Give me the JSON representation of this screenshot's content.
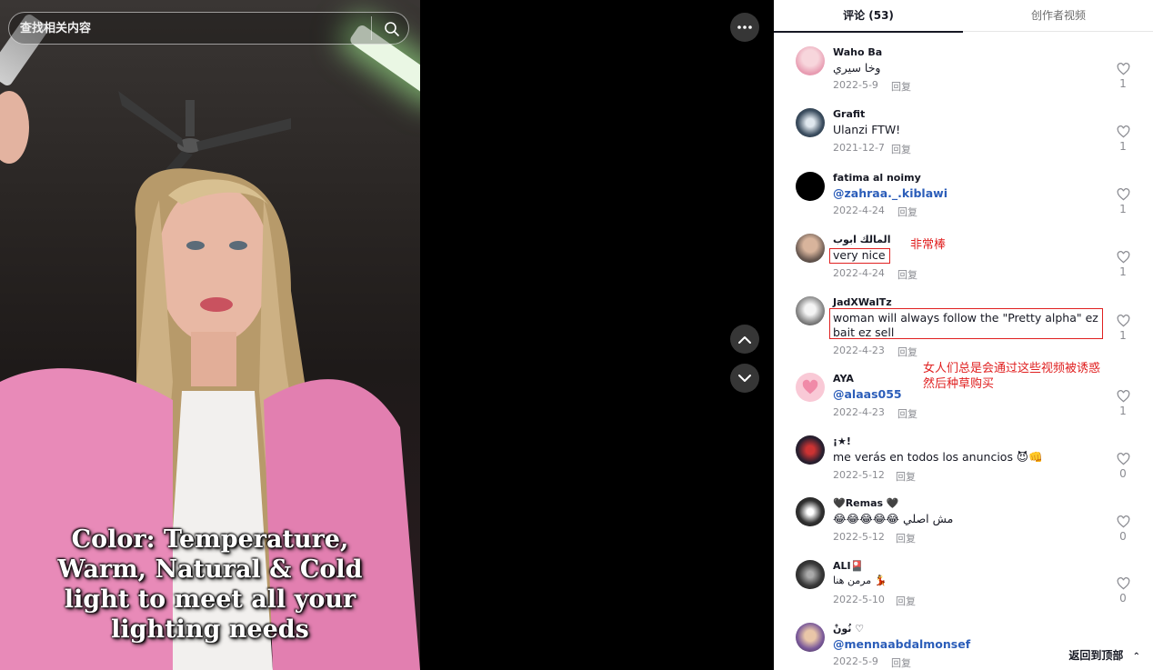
{
  "search": {
    "placeholder": "查找相关内容",
    "icon": "search-icon"
  },
  "video": {
    "caption": "Color: Temperature, Warm, Natural & Cold light to meet all your lighting needs"
  },
  "controls": {
    "more_icon": "more-horizontal-icon",
    "prev_icon": "chevron-up-icon",
    "next_icon": "chevron-down-icon"
  },
  "tabs": [
    {
      "label": "评论 (53)",
      "active": true
    },
    {
      "label": "创作者视频",
      "active": false
    }
  ],
  "comments": [
    {
      "user": "Waho Ba",
      "text": "وخا سيري",
      "date": "2022-5-9",
      "reply": "回复",
      "likes": "1"
    },
    {
      "user": "Grafit",
      "text": "Ulanzi FTW!",
      "date": "2021-12-7",
      "reply": "回复",
      "likes": "1"
    },
    {
      "user": "fatima al noimy",
      "text": "@zahraa._.kiblawi",
      "date": "2022-4-24",
      "reply": "回复",
      "likes": "1"
    },
    {
      "user": "المالك ابوب",
      "text": "very nice",
      "date": "2022-4-24",
      "reply": "回复",
      "likes": "1"
    },
    {
      "user": "JadXWalTz",
      "text": "woman will always follow the \"Pretty alpha\" ez bait ez sell",
      "date": "2022-4-23",
      "reply": "回复",
      "likes": "1"
    },
    {
      "user": "AYA",
      "text": "@alaas055",
      "date": "2022-4-23",
      "reply": "回复",
      "likes": "1"
    },
    {
      "user": "¡★!",
      "text": "me verás en todos los anuncios 😈👊",
      "date": "2022-5-12",
      "reply": "回复",
      "likes": "0"
    },
    {
      "user": "🖤Remas 🖤",
      "text": "😂😂😂😂😂 مش اصلي",
      "date": "2022-5-12",
      "reply": "回复",
      "likes": "0"
    },
    {
      "user": "ALI🎴",
      "text": "مرمن هنا 💃",
      "date": "2022-5-10",
      "reply": "回复",
      "likes": "0"
    },
    {
      "user": "نُونْ ♡",
      "text": "@mennaabdalmonsef",
      "date": "2022-5-9",
      "reply": "回复",
      "likes": ""
    }
  ],
  "annotations": {
    "very_nice": "非常棒",
    "woman_line1": "女人们总是会通过这些视频被诱惑",
    "woman_line2": "然后种草购买"
  },
  "back_to_top": "返回到顶部",
  "colors": {
    "annotation": "#e02020",
    "mention": "#2b5db9",
    "active_tab": "#161823"
  }
}
